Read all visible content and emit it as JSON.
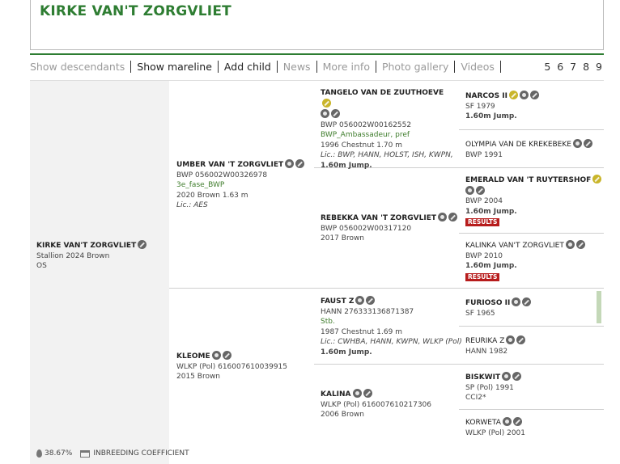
{
  "header": {
    "title": "KIRKE VAN'T ZORGVLIET"
  },
  "tabs": [
    {
      "label": "Show descendants",
      "active": false
    },
    {
      "label": "Show mareline",
      "active": true
    },
    {
      "label": "Add child",
      "active": true
    },
    {
      "label": "News",
      "active": false
    },
    {
      "label": "More info",
      "active": false
    },
    {
      "label": "Photo gallery",
      "active": false
    },
    {
      "label": "Videos",
      "active": false
    }
  ],
  "pagination": "5 6 7 8 9",
  "subject": {
    "name": "KIRKE VAN'T ZORGVLIET",
    "line1": "Stallion 2024 Brown",
    "line2": "OS"
  },
  "sire": {
    "name": "UMBER VAN 'T ZORGVLIET",
    "reg": "BWP 056002W00326978",
    "title": "3e_fase_BWP",
    "info": "2020 Brown 1.63 m",
    "lic": "Lic.: AES"
  },
  "dam": {
    "name": "KLEOME",
    "reg": "WLKP (Pol) 616007610039915",
    "info": "2015 Brown"
  },
  "gen3": [
    {
      "name": "TANGELO VAN DE ZUUTHOEVE",
      "reg": "BWP 056002W00162552",
      "title": "BWP_Ambassadeur, pref",
      "info": "1996 Chestnut 1.70 m",
      "lic": "Lic.: BWP, HANN, HOLST, ISH, KWPN, OL...",
      "sport": "1.60m Jump."
    },
    {
      "name": "REBEKKA VAN 'T ZORGVLIET",
      "reg": "BWP 056002W00317120",
      "info": "2017 Brown"
    },
    {
      "name": "FAUST Z",
      "reg": "HANN 276333136871387",
      "title": "Stb.",
      "info": "1987 Chestnut 1.69 m",
      "lic": "Lic.: CWHBA, HANN, KWPN, WLKP (Pol)",
      "sport": "1.60m Jump."
    },
    {
      "name": "KALINA",
      "reg": "WLKP (Pol) 616007610217306",
      "info": "2006 Brown"
    }
  ],
  "gen4": [
    {
      "name": "NARCOS II",
      "reg": "SF 1979",
      "sport": "1.60m Jump."
    },
    {
      "name": "OLYMPIA VAN DE KREKEBEKE",
      "reg": "BWP 1991"
    },
    {
      "name": "EMERALD VAN 'T RUYTERSHOF",
      "reg": "BWP 2004",
      "sport": "1.60m Jump.",
      "badge": "RESULTS"
    },
    {
      "name": "KALINKA VAN'T ZORGVLIET",
      "reg": "BWP 2010",
      "sport": "1.60m Jump.",
      "badge": "RESULTS"
    },
    {
      "name": "FURIOSO II",
      "reg": "SF 1965"
    },
    {
      "name": "REURIKA Z",
      "reg": "HANN 1982"
    },
    {
      "name": "BISKWIT",
      "reg": "SP (Pol) 1991",
      "sport": "CCI2*"
    },
    {
      "name": "KORWETA",
      "reg": "WLKP (Pol) 2001"
    }
  ],
  "footer": {
    "percent": "38.67%",
    "label": "INBREEDING COEFFICIENT"
  },
  "colors": {
    "brand": "#2e7d32",
    "badge": "#b71c1c",
    "gold-icon": "#c9b52a"
  }
}
